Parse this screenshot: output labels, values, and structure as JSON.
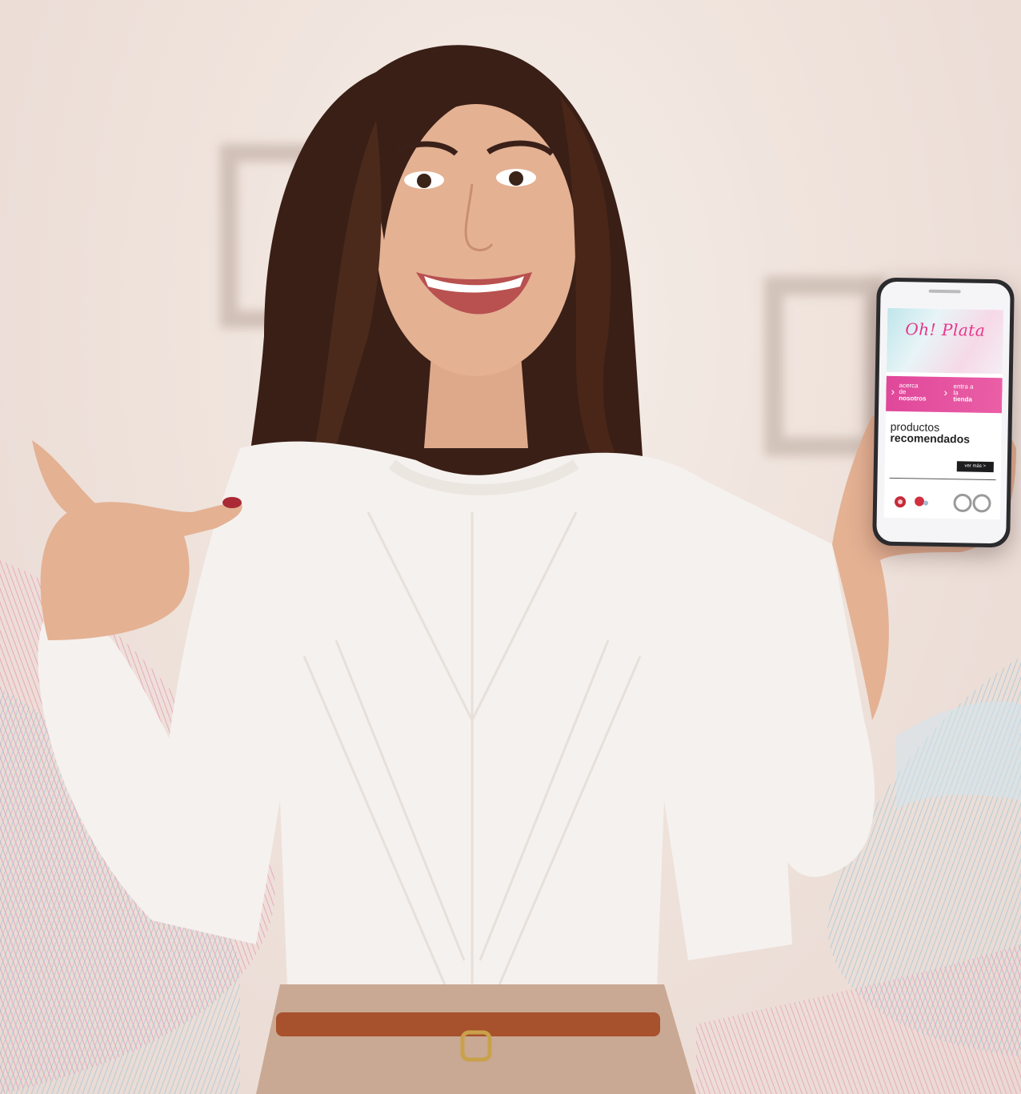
{
  "phone": {
    "logo": "Oh! Plata",
    "logo_tagline": "",
    "nav": [
      {
        "line1": "acerca",
        "line2": "de",
        "line3": "nosotros"
      },
      {
        "line1": "entra a",
        "line2": "la",
        "line3": "tienda"
      }
    ],
    "section_title_light": "productos",
    "section_title_bold": "recomendados",
    "cta_label": "ver más >",
    "chevron": "›"
  },
  "colors": {
    "brand_pink": "#e6358b",
    "band_pink": "#e0479a",
    "blouse": "#f5f1ee",
    "hair": "#3a1f16",
    "skin": "#e4b193",
    "belt": "#a8512d"
  }
}
